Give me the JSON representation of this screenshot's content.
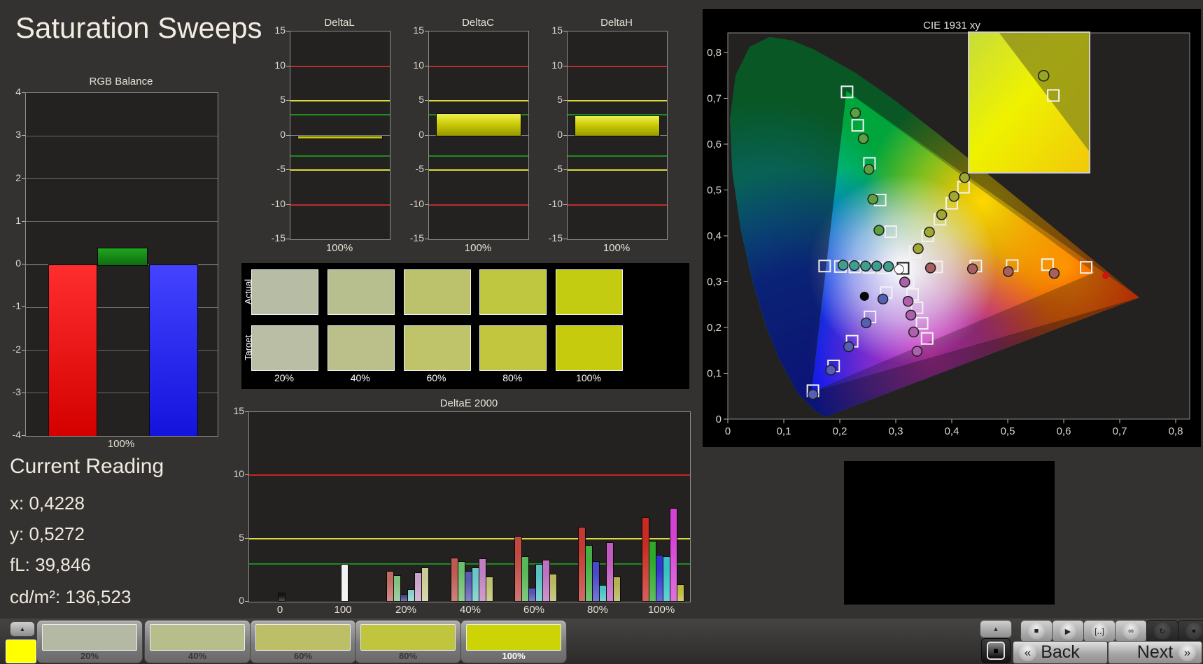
{
  "window": {
    "title": "Saturation Sweeps"
  },
  "rgb_balance": {
    "title": "RGB Balance",
    "x_label": "100%",
    "y_ticks": [
      4,
      3,
      2,
      1,
      0,
      -1,
      -2,
      -3,
      -4
    ],
    "bars": [
      {
        "name": "red",
        "value": -4,
        "clipped": true,
        "color_top": "#ff2e2e",
        "color_bottom": "#d40000"
      },
      {
        "name": "green",
        "value": 0.4,
        "clipped": false,
        "color_top": "#21a521",
        "color_bottom": "#0e6d0e"
      },
      {
        "name": "blue",
        "value": -4,
        "clipped": true,
        "color_top": "#4343ff",
        "color_bottom": "#1313dd"
      }
    ]
  },
  "delta_axis": {
    "y_ticks": [
      15,
      10,
      5,
      0,
      -5,
      -10,
      -15
    ],
    "x_label": "100%",
    "limit_lines": [
      {
        "value": 10,
        "color": "#b82f2f"
      },
      {
        "value": 5,
        "color": "#ddda3d"
      },
      {
        "value": 3,
        "color": "#1f8a1f"
      },
      {
        "value": 0,
        "color": "#8a8a8a"
      },
      {
        "value": -3,
        "color": "#1f8a1f"
      },
      {
        "value": -5,
        "color": "#ddda3d"
      },
      {
        "value": -10,
        "color": "#b82f2f"
      }
    ]
  },
  "delta_charts": [
    {
      "title": "DeltaL",
      "value": -0.35
    },
    {
      "title": "DeltaC",
      "value": 3.2
    },
    {
      "title": "DeltaH",
      "value": 2.85
    }
  ],
  "swatch_table": {
    "row_labels": [
      "Actual",
      "Target"
    ],
    "col_labels": [
      "20%",
      "40%",
      "60%",
      "80%",
      "100%"
    ],
    "actual_colors": [
      "#b7bda5",
      "#b8bf8e",
      "#bcc26b",
      "#bfc640",
      "#c3cc10"
    ],
    "target_colors": [
      "#b9bea4",
      "#bbc08b",
      "#bfc369",
      "#c2c63e",
      "#c6cb0e"
    ]
  },
  "deltae": {
    "title": "DeltaE 2000",
    "y_ticks": [
      15,
      10,
      5,
      0
    ],
    "limit_lines": [
      {
        "value": 10,
        "color": "#c22525"
      },
      {
        "value": 5,
        "color": "#ddda3d"
      },
      {
        "value": 3,
        "color": "#1f8a1f"
      }
    ],
    "groups": [
      {
        "label": "0",
        "bars": [
          {
            "color": "#151515",
            "value": 0.6
          }
        ]
      },
      {
        "label": "100",
        "bars": [
          {
            "color": "#f2f2f2",
            "value": 2.9
          }
        ]
      },
      {
        "label": "20%",
        "bars": [
          {
            "color": "#c06a60",
            "value": 2.3
          },
          {
            "color": "#84c084",
            "value": 2.0
          },
          {
            "color": "#4a4a88",
            "value": 0.5
          },
          {
            "color": "#86d2ca",
            "value": 0.9
          },
          {
            "color": "#c9a2c9",
            "value": 2.2
          },
          {
            "color": "#cbcb98",
            "value": 2.6
          }
        ]
      },
      {
        "label": "40%",
        "bars": [
          {
            "color": "#bd5a52",
            "value": 3.4
          },
          {
            "color": "#6cbe6c",
            "value": 3.1
          },
          {
            "color": "#5a5ab2",
            "value": 2.3
          },
          {
            "color": "#6cc8c8",
            "value": 2.6
          },
          {
            "color": "#c07fc0",
            "value": 3.3
          },
          {
            "color": "#bfbf70",
            "value": 1.9
          }
        ]
      },
      {
        "label": "60%",
        "bars": [
          {
            "color": "#c04a42",
            "value": 5.1
          },
          {
            "color": "#57b857",
            "value": 3.5
          },
          {
            "color": "#5252b8",
            "value": 1.0
          },
          {
            "color": "#58c2c2",
            "value": 2.9
          },
          {
            "color": "#bf70bf",
            "value": 3.2
          },
          {
            "color": "#b8b862",
            "value": 2.1
          }
        ]
      },
      {
        "label": "80%",
        "bars": [
          {
            "color": "#c23a32",
            "value": 5.8
          },
          {
            "color": "#42b042",
            "value": 4.4
          },
          {
            "color": "#4a4ac8",
            "value": 3.1
          },
          {
            "color": "#4ac2c2",
            "value": 1.2
          },
          {
            "color": "#c25ac2",
            "value": 4.6
          },
          {
            "color": "#b2b252",
            "value": 1.9
          }
        ]
      },
      {
        "label": "100%",
        "bars": [
          {
            "color": "#ca2a22",
            "value": 6.6
          },
          {
            "color": "#2caa2c",
            "value": 4.7
          },
          {
            "color": "#3434d2",
            "value": 3.6
          },
          {
            "color": "#34c2c2",
            "value": 3.5
          },
          {
            "color": "#d442d4",
            "value": 7.3
          },
          {
            "color": "#baba3a",
            "value": 1.3
          }
        ]
      }
    ]
  },
  "cie": {
    "title": "CIE 1931 xy",
    "x_ticks": [
      "0",
      "0,1",
      "0,2",
      "0,3",
      "0,4",
      "0,5",
      "0,6",
      "0,7",
      "0,8"
    ],
    "y_ticks": [
      "0",
      "0,1",
      "0,2",
      "0,3",
      "0,4",
      "0,5",
      "0,6",
      "0,7",
      "0,8"
    ],
    "white_point": {
      "target": [
        0.313,
        0.329
      ],
      "measured": [
        0.306,
        0.327
      ]
    },
    "black_dot": [
      0.244,
      0.268
    ],
    "red_dot": [
      0.675,
      0.313
    ],
    "sweeps": [
      {
        "name": "red",
        "circle_fill": "#a85f5f",
        "targets": [
          [
            0.373,
            0.332
          ],
          [
            0.443,
            0.334
          ],
          [
            0.508,
            0.335
          ],
          [
            0.571,
            0.337
          ],
          [
            0.64,
            0.331
          ]
        ],
        "measured": [
          [
            0.362,
            0.33
          ],
          [
            0.437,
            0.328
          ],
          [
            0.501,
            0.322
          ],
          [
            0.583,
            0.318
          ]
        ]
      },
      {
        "name": "green",
        "circle_fill": "#5aa13f",
        "targets": [
          [
            0.291,
            0.409
          ],
          [
            0.272,
            0.478
          ],
          [
            0.253,
            0.558
          ],
          [
            0.232,
            0.641
          ],
          [
            0.213,
            0.714
          ]
        ],
        "measured": [
          [
            0.27,
            0.412
          ],
          [
            0.259,
            0.48
          ],
          [
            0.252,
            0.545
          ],
          [
            0.242,
            0.612
          ],
          [
            0.228,
            0.668
          ]
        ]
      },
      {
        "name": "blue",
        "circle_fill": "#5560b5",
        "targets": [
          [
            0.283,
            0.276
          ],
          [
            0.254,
            0.223
          ],
          [
            0.222,
            0.17
          ],
          [
            0.189,
            0.116
          ],
          [
            0.152,
            0.062
          ]
        ],
        "measured": [
          [
            0.277,
            0.262
          ],
          [
            0.247,
            0.21
          ],
          [
            0.216,
            0.158
          ],
          [
            0.184,
            0.107
          ],
          [
            0.152,
            0.054
          ]
        ]
      },
      {
        "name": "cyan",
        "circle_fill": "#3f9f8f",
        "targets": [
          [
            0.278,
            0.33
          ],
          [
            0.252,
            0.331
          ],
          [
            0.227,
            0.332
          ],
          [
            0.201,
            0.333
          ],
          [
            0.173,
            0.334
          ]
        ],
        "measured": [
          [
            0.287,
            0.333
          ],
          [
            0.266,
            0.334
          ],
          [
            0.246,
            0.334
          ],
          [
            0.226,
            0.335
          ],
          [
            0.206,
            0.336
          ]
        ]
      },
      {
        "name": "magenta",
        "circle_fill": "#b05fae",
        "targets": [
          [
            0.322,
            0.3
          ],
          [
            0.33,
            0.272
          ],
          [
            0.338,
            0.243
          ],
          [
            0.347,
            0.209
          ],
          [
            0.356,
            0.176
          ]
        ],
        "measured": [
          [
            0.316,
            0.299
          ],
          [
            0.322,
            0.257
          ],
          [
            0.327,
            0.227
          ],
          [
            0.332,
            0.19
          ],
          [
            0.338,
            0.148
          ]
        ]
      },
      {
        "name": "yellow",
        "circle_fill": "#a0a832",
        "targets": [
          [
            0.335,
            0.365
          ],
          [
            0.357,
            0.4
          ],
          [
            0.379,
            0.436
          ],
          [
            0.4,
            0.471
          ],
          [
            0.421,
            0.506
          ]
        ],
        "measured": [
          [
            0.34,
            0.372
          ],
          [
            0.36,
            0.408
          ],
          [
            0.382,
            0.446
          ],
          [
            0.404,
            0.486
          ],
          [
            0.423,
            0.527
          ]
        ]
      }
    ],
    "inset": {
      "circle_rel": [
        0.62,
        0.31
      ],
      "square_rel": [
        0.7,
        0.45
      ]
    }
  },
  "current_reading": {
    "title": "Current Reading",
    "lines": [
      {
        "label": "x:",
        "value": "0,4228"
      },
      {
        "label": "y:",
        "value": "0,5272"
      },
      {
        "label": "fL:",
        "value": "39,846"
      },
      {
        "label": "cd/m²:",
        "value": "136,523"
      }
    ]
  },
  "bottom_bar": {
    "collapse_icon": "▲",
    "current_color": "#ffff00",
    "swatch_buttons": [
      {
        "label": "20%",
        "color": "#b3b9a2",
        "selected": false
      },
      {
        "label": "40%",
        "color": "#b7bd8b",
        "selected": false
      },
      {
        "label": "60%",
        "color": "#bcbf66",
        "selected": false
      },
      {
        "label": "80%",
        "color": "#c1c43d",
        "selected": false
      },
      {
        "label": "100%",
        "color": "#ccd405",
        "selected": true
      }
    ],
    "transport": [
      {
        "name": "stop",
        "glyph": "■",
        "dark": false
      },
      {
        "name": "play",
        "glyph": "▶",
        "dark": false
      },
      {
        "name": "pattern-size",
        "glyph": "[‥]",
        "dark": false
      },
      {
        "name": "continuous",
        "glyph": "∞",
        "dark": false
      },
      {
        "name": "refresh",
        "glyph": "↻",
        "dark": true
      },
      {
        "name": "record",
        "glyph": "●",
        "dark": true
      }
    ],
    "pattern_toggle_icon": "■",
    "back_label": "Back",
    "next_label": "Next",
    "back_icon": "«",
    "next_icon": "»"
  }
}
